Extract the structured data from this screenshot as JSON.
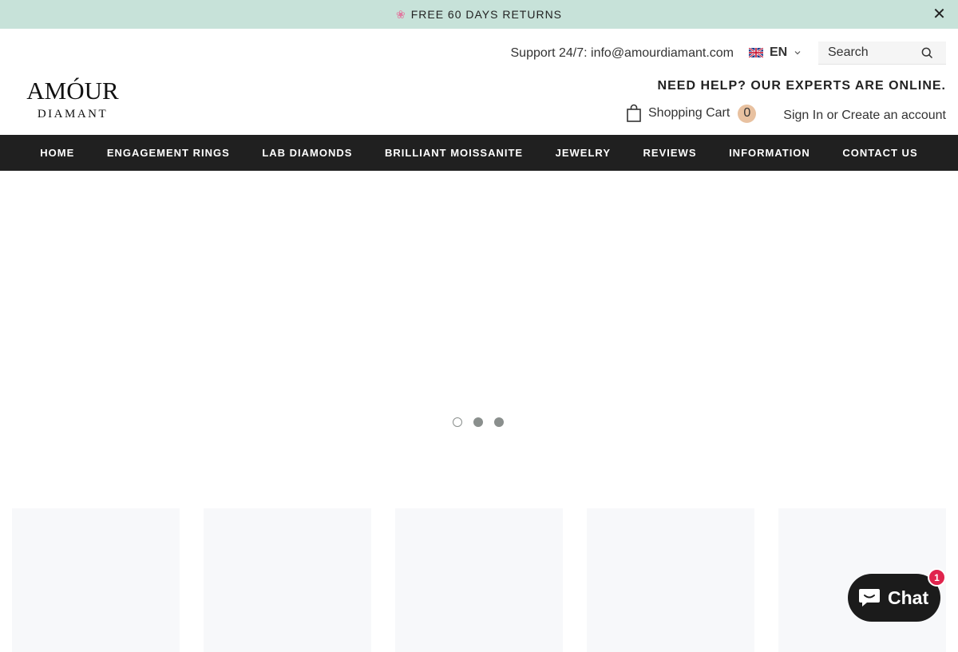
{
  "announcement": {
    "icon": "flower-icon",
    "text": "FREE 60 DAYS RETURNS"
  },
  "header": {
    "logo": {
      "top": "AMÓUR",
      "bottom": "DIAMANT"
    },
    "support": "Support 24/7: info@amourdiamant.com",
    "language": "EN",
    "search_placeholder": "Search",
    "help": "NEED HELP? OUR EXPERTS ARE ONLINE.",
    "cart_label": "Shopping Cart",
    "cart_count": "0",
    "sign_in": "Sign In",
    "or": "or",
    "create_account": "Create an account"
  },
  "nav": [
    "HOME",
    "ENGAGEMENT RINGS",
    "LAB DIAMONDS",
    "BRILLIANT MOISSANITE",
    "JEWELRY",
    "REVIEWS",
    "INFORMATION",
    "CONTACT US"
  ],
  "slider": {
    "slides": 3,
    "active": 1
  },
  "chat": {
    "label": "Chat",
    "badge": "1"
  },
  "colors": {
    "announcement_bg": "#c7e2d9",
    "nav_bg": "#202020",
    "cart_badge": "#e8c1a0",
    "chat_bg": "#1b1b1b",
    "chat_badge": "#e0244d"
  }
}
